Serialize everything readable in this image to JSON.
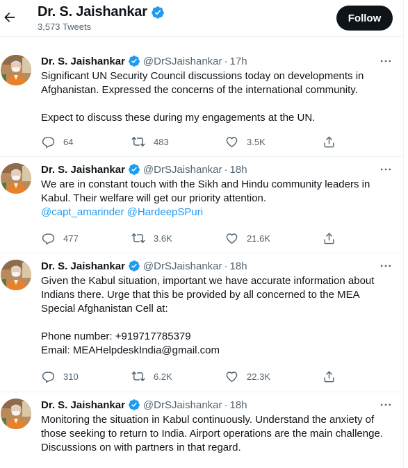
{
  "header": {
    "name": "Dr. S. Jaishankar",
    "tweet_count": "3,573 Tweets",
    "follow_label": "Follow"
  },
  "icons": {
    "back": "arrow-left-icon",
    "verified": "verified-badge-icon",
    "more": "more-dots-icon",
    "reply": "reply-icon",
    "retweet": "retweet-icon",
    "like": "heart-icon",
    "share": "share-icon"
  },
  "colors": {
    "verified": "#1d9bf0",
    "mention": "#1d9bf0",
    "follow_bg": "#0f1419",
    "muted": "#536471"
  },
  "tweets": [
    {
      "name": "Dr. S. Jaishankar",
      "handle": "@DrSJaishankar",
      "sep": "·",
      "time": "17h",
      "lines": [
        "Significant UN Security Council discussions today on developments in",
        "Afghanistan. Expressed the concerns of the international community.",
        "",
        "Expect to discuss these during my engagements at the UN."
      ],
      "replies": "64",
      "retweets": "483",
      "likes": "3.5K"
    },
    {
      "name": "Dr. S. Jaishankar",
      "handle": "@DrSJaishankar",
      "sep": "·",
      "time": "18h",
      "lines": [
        "We are in constant touch with the Sikh and Hindu community leaders in",
        "Kabul. Their welfare will get our priority attention."
      ],
      "mention_1": "@capt_amarinder",
      "mention_2": "@HardeepSPuri",
      "replies": "477",
      "retweets": "3.6K",
      "likes": "21.6K"
    },
    {
      "name": "Dr. S. Jaishankar",
      "handle": "@DrSJaishankar",
      "sep": "·",
      "time": "18h",
      "lines": [
        "Given the Kabul situation, important we have accurate information about",
        "Indians there. Urge that this be provided by all concerned to the MEA",
        "Special Afghanistan Cell at:",
        "",
        "Phone number: +919717785379",
        "Email: MEAHelpdeskIndia@gmail.com"
      ],
      "replies": "310",
      "retweets": "6.2K",
      "likes": "22.3K"
    },
    {
      "name": "Dr. S. Jaishankar",
      "handle": "@DrSJaishankar",
      "sep": "·",
      "time": "18h",
      "lines": [
        "Monitoring the situation in Kabul continuously. Understand the anxiety of",
        "those seeking to return to India. Airport operations are the main challenge.",
        "Discussions on with partners in that regard."
      ]
    }
  ]
}
